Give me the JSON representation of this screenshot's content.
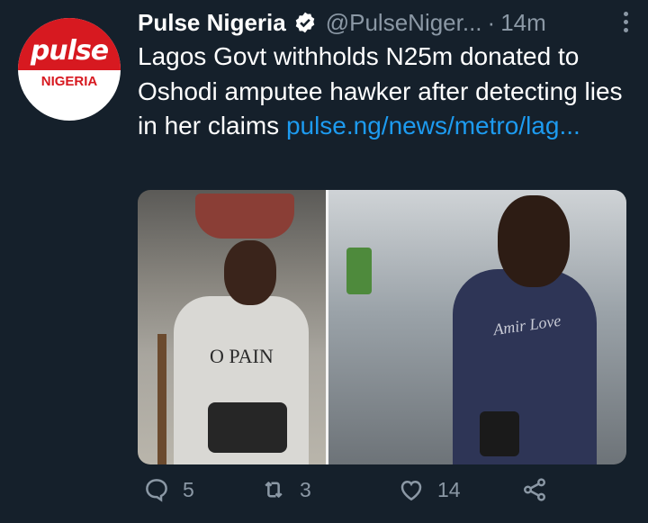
{
  "account": {
    "avatar_logo_word": "pulse",
    "avatar_logo_sub": "NIGERIA",
    "display_name": "Pulse Nigeria",
    "handle": "@PulseNiger...",
    "separator": "·",
    "time": "14m"
  },
  "tweet": {
    "text": "Lagos Govt withholds N25m donated to Oshodi amputee hawker after detecting lies in her claims ",
    "link": "pulse.ng/news/metro/lag..."
  },
  "media": {
    "left_photo_shirt_text": "O PAIN",
    "right_photo_shirt_text": "Amir Love"
  },
  "actions": {
    "replies": "5",
    "retweets": "3",
    "likes": "14"
  },
  "colors": {
    "background": "#15202b",
    "text": "#ffffff",
    "secondary": "#8b98a5",
    "link": "#1d9bf0",
    "brand_red": "#d71920"
  },
  "icons": [
    "verified-badge-icon",
    "more-options-icon",
    "reply-icon",
    "retweet-icon",
    "like-icon",
    "share-icon"
  ]
}
